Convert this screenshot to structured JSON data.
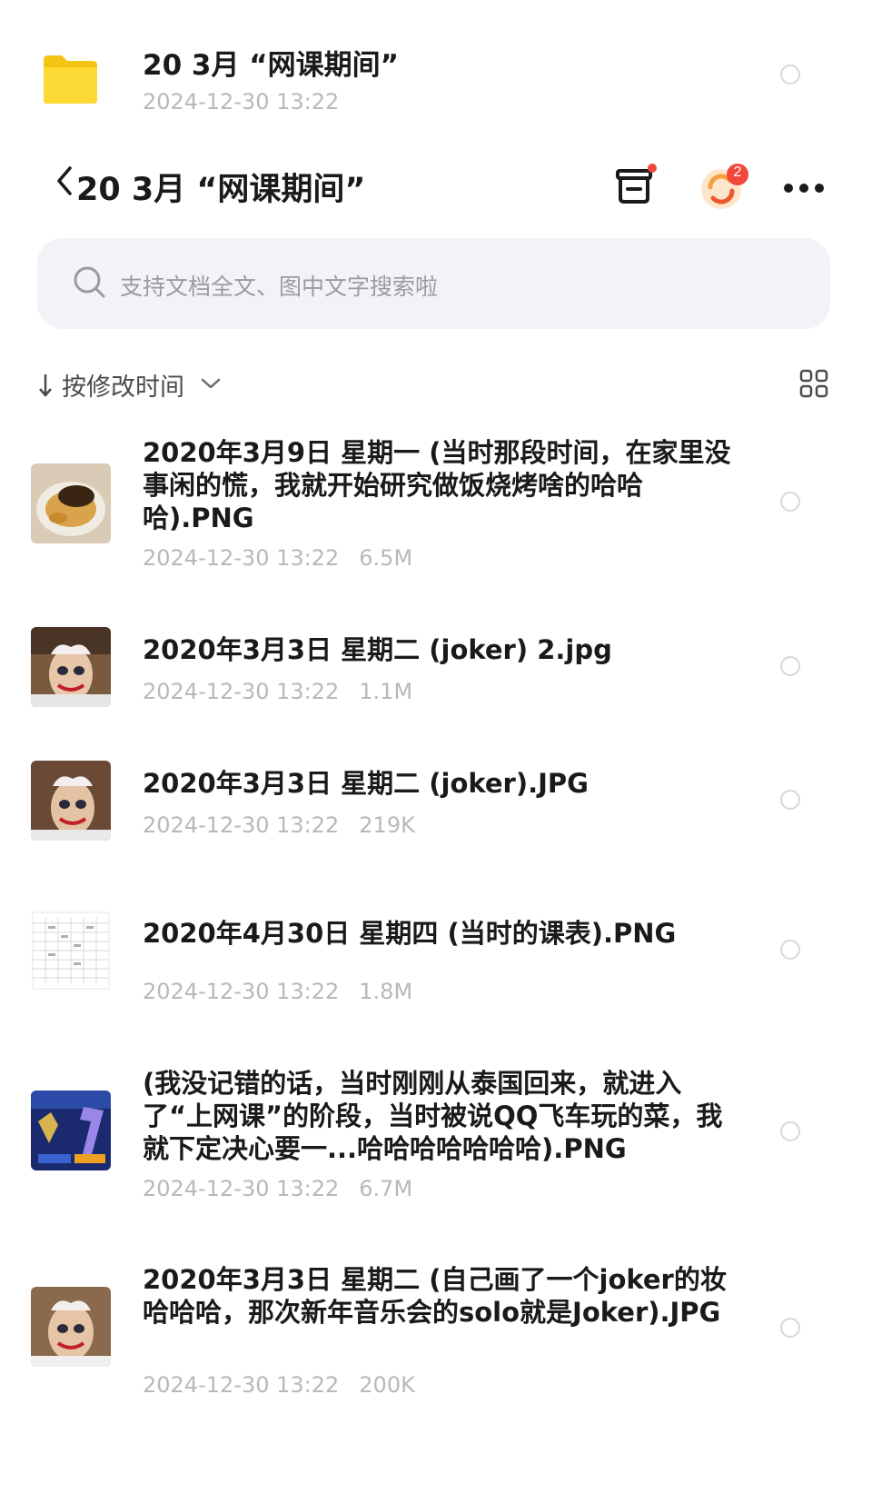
{
  "top_folder": {
    "title": "20 3月 “网课期间”",
    "date": "2024-12-30 13:22",
    "icon": "folder-icon",
    "icon_color": "#f7cf1c"
  },
  "header": {
    "title": "20 3月 “网课期间”",
    "sync_badge": "2"
  },
  "search": {
    "placeholder": "支持文档全文、图中文字搜索啦"
  },
  "sort": {
    "label": "按修改时间"
  },
  "files": [
    {
      "name": "2020年3月9日 星期一 (当时那段时间，在家里没事闲的慌，我就开始研究做饭烧烤啥的哈哈哈).PNG",
      "date": "2024-12-30 13:22",
      "size": "6.5M",
      "thumb": "food-thumbnail"
    },
    {
      "name": "2020年3月3日 星期二 (joker) 2.jpg",
      "date": "2024-12-30 13:22",
      "size": "1.1M",
      "thumb": "joker-face-thumbnail"
    },
    {
      "name": "2020年3月3日 星期二 (joker).JPG",
      "date": "2024-12-30 13:22",
      "size": "219K",
      "thumb": "joker-face-thumbnail"
    },
    {
      "name": "2020年4月30日 星期四 (当时的课表).PNG",
      "date": "2024-12-30 13:22",
      "size": "1.8M",
      "thumb": "timetable-thumbnail"
    },
    {
      "name": "(我没记错的话，当时刚刚从泰国回来，就进入了“上网课”的阶段，当时被说QQ飞车玩的菜，我就下定决心要一...哈哈哈哈哈哈哈).PNG",
      "date": "2024-12-30 13:22",
      "size": "6.7M",
      "thumb": "game-thumbnail"
    },
    {
      "name": "2020年3月3日 星期二 (自己画了一个joker的妆哈哈哈，那次新年音乐会的solo就是Joker).JPG",
      "date": "2024-12-30 13:22",
      "size": "200K",
      "thumb": "joker-face-thumbnail"
    }
  ],
  "colors": {
    "badge_red": "#f2473d",
    "sync_orange": "#f6a23a",
    "meta_gray": "#b8b8bd",
    "search_bg": "#f2f3f6"
  }
}
